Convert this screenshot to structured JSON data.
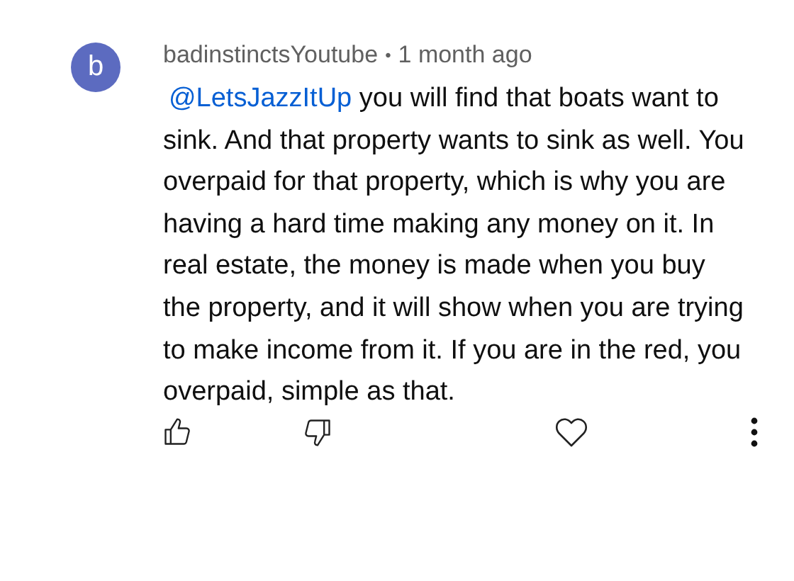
{
  "comment": {
    "avatar_letter": "b",
    "author": "badinstinctsYoutube",
    "separator": "•",
    "time": "1 month ago",
    "mention": "@LetsJazzItUp",
    "text": "you will find that boats want to sink. And that property wants to sink as well. You overpaid for that property, which is why you are having a hard time making any money on it. In real estate, the money is made when you buy the property, and it will show when you are trying to make income from it. If you are in the red, you overpaid, simple as that."
  }
}
